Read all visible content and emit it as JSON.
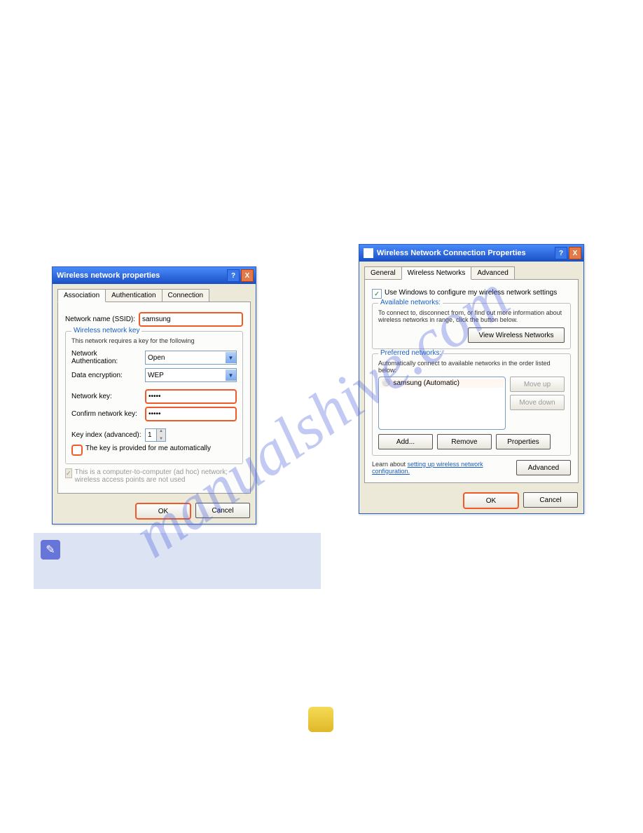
{
  "watermark": "manualshive.com",
  "dialog1": {
    "title": "Wireless network properties",
    "tabs": [
      "Association",
      "Authentication",
      "Connection"
    ],
    "ssid_label": "Network name (SSID):",
    "ssid_value": "samsung",
    "group_legend": "Wireless network key",
    "requires_text": "This network requires a key for the following",
    "net_auth_label": "Network Authentication:",
    "net_auth_value": "Open",
    "data_enc_label": "Data encryption:",
    "data_enc_value": "WEP",
    "netkey_label": "Network key:",
    "netkey_value": "•••••",
    "confkey_label": "Confirm network key:",
    "confkey_value": "•••••",
    "keyindex_label": "Key index (advanced):",
    "keyindex_value": "1",
    "chk_autokey": "The key is provided for me automatically",
    "chk_adhoc": "This is a computer-to-computer (ad hoc) network; wireless access points are not used",
    "ok": "OK",
    "cancel": "Cancel"
  },
  "dialog2": {
    "title": "Wireless Network Connection Properties",
    "tabs": [
      "General",
      "Wireless Networks",
      "Advanced"
    ],
    "chk_use_windows": "Use Windows to configure my wireless network settings",
    "available_legend": "Available networks:",
    "available_text": "To connect to, disconnect from, or find out more information about wireless networks in range, click the button below.",
    "view_btn": "View Wireless Networks",
    "preferred_legend": "Preferred networks:",
    "preferred_text": "Automatically connect to available networks in the order listed below:",
    "list_item": "samsung (Automatic)",
    "moveup": "Move up",
    "movedown": "Move down",
    "add": "Add...",
    "remove": "Remove",
    "properties": "Properties",
    "learn_text": "Learn about ",
    "learn_link": "setting up wireless network configuration.",
    "advanced": "Advanced",
    "ok": "OK",
    "cancel": "Cancel"
  },
  "note": {
    "text": ""
  },
  "page_number": ""
}
